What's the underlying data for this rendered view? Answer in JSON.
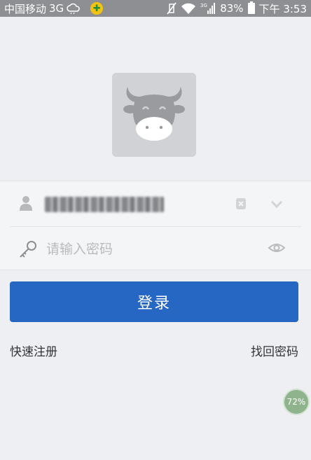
{
  "status_bar": {
    "carrier": "中国移动",
    "network": "3G",
    "battery": "83%",
    "time": "下午 3:53",
    "icons": [
      "cloud-icon",
      "app-badge-icon",
      "mute-icon",
      "wifi-icon",
      "signal-icon",
      "battery-icon"
    ]
  },
  "logo": {
    "icon": "cow-logo-icon"
  },
  "form": {
    "username_icon": "user-icon",
    "username_value_blurred": true,
    "clear_icon": "clear-icon",
    "dropdown_icon": "chevron-down-icon",
    "password_icon": "key-icon",
    "password_placeholder": "请输入密码",
    "password_toggle_icon": "eye-icon"
  },
  "actions": {
    "login_label": "登录",
    "register_label": "快速注册",
    "recover_label": "找回密码"
  },
  "floating_badge": {
    "text": "72%"
  },
  "colors": {
    "primary": "#2767c4",
    "background": "#eeeff3",
    "status_bar": "#8d8f93",
    "badge": "#8fb48d"
  }
}
